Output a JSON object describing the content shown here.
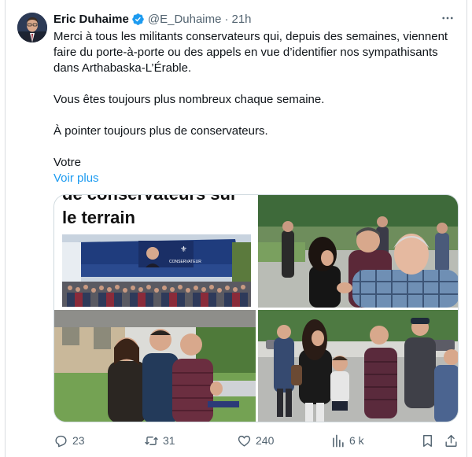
{
  "tweet": {
    "author_name": "Eric Duhaime",
    "handle": "@E_Duhaime",
    "separator": "·",
    "time": "21h",
    "paragraphs": [
      "Merci à tous les militants conservateurs qui, depuis des semaines, viennent faire du porte-à-porte ou des appels en vue d’identifier nos sympathisants dans Arthabaska-L’Érable.",
      "Vous êtes toujours plus nombreux chaque semaine.",
      "À pointer toujours plus de conservateurs.",
      "Votre"
    ],
    "show_more": "Voir plus"
  },
  "media": {
    "headline_partial": "de conservateurs sur",
    "headline": "le terrain",
    "banner_text": "CONSERVATEUR"
  },
  "actions": {
    "replies": "23",
    "reposts": "31",
    "likes": "240",
    "views": "6 k"
  },
  "colors": {
    "text": "#0f1419",
    "muted": "#536471",
    "link": "#1d9bf0",
    "verified": "#1d9bf0"
  }
}
